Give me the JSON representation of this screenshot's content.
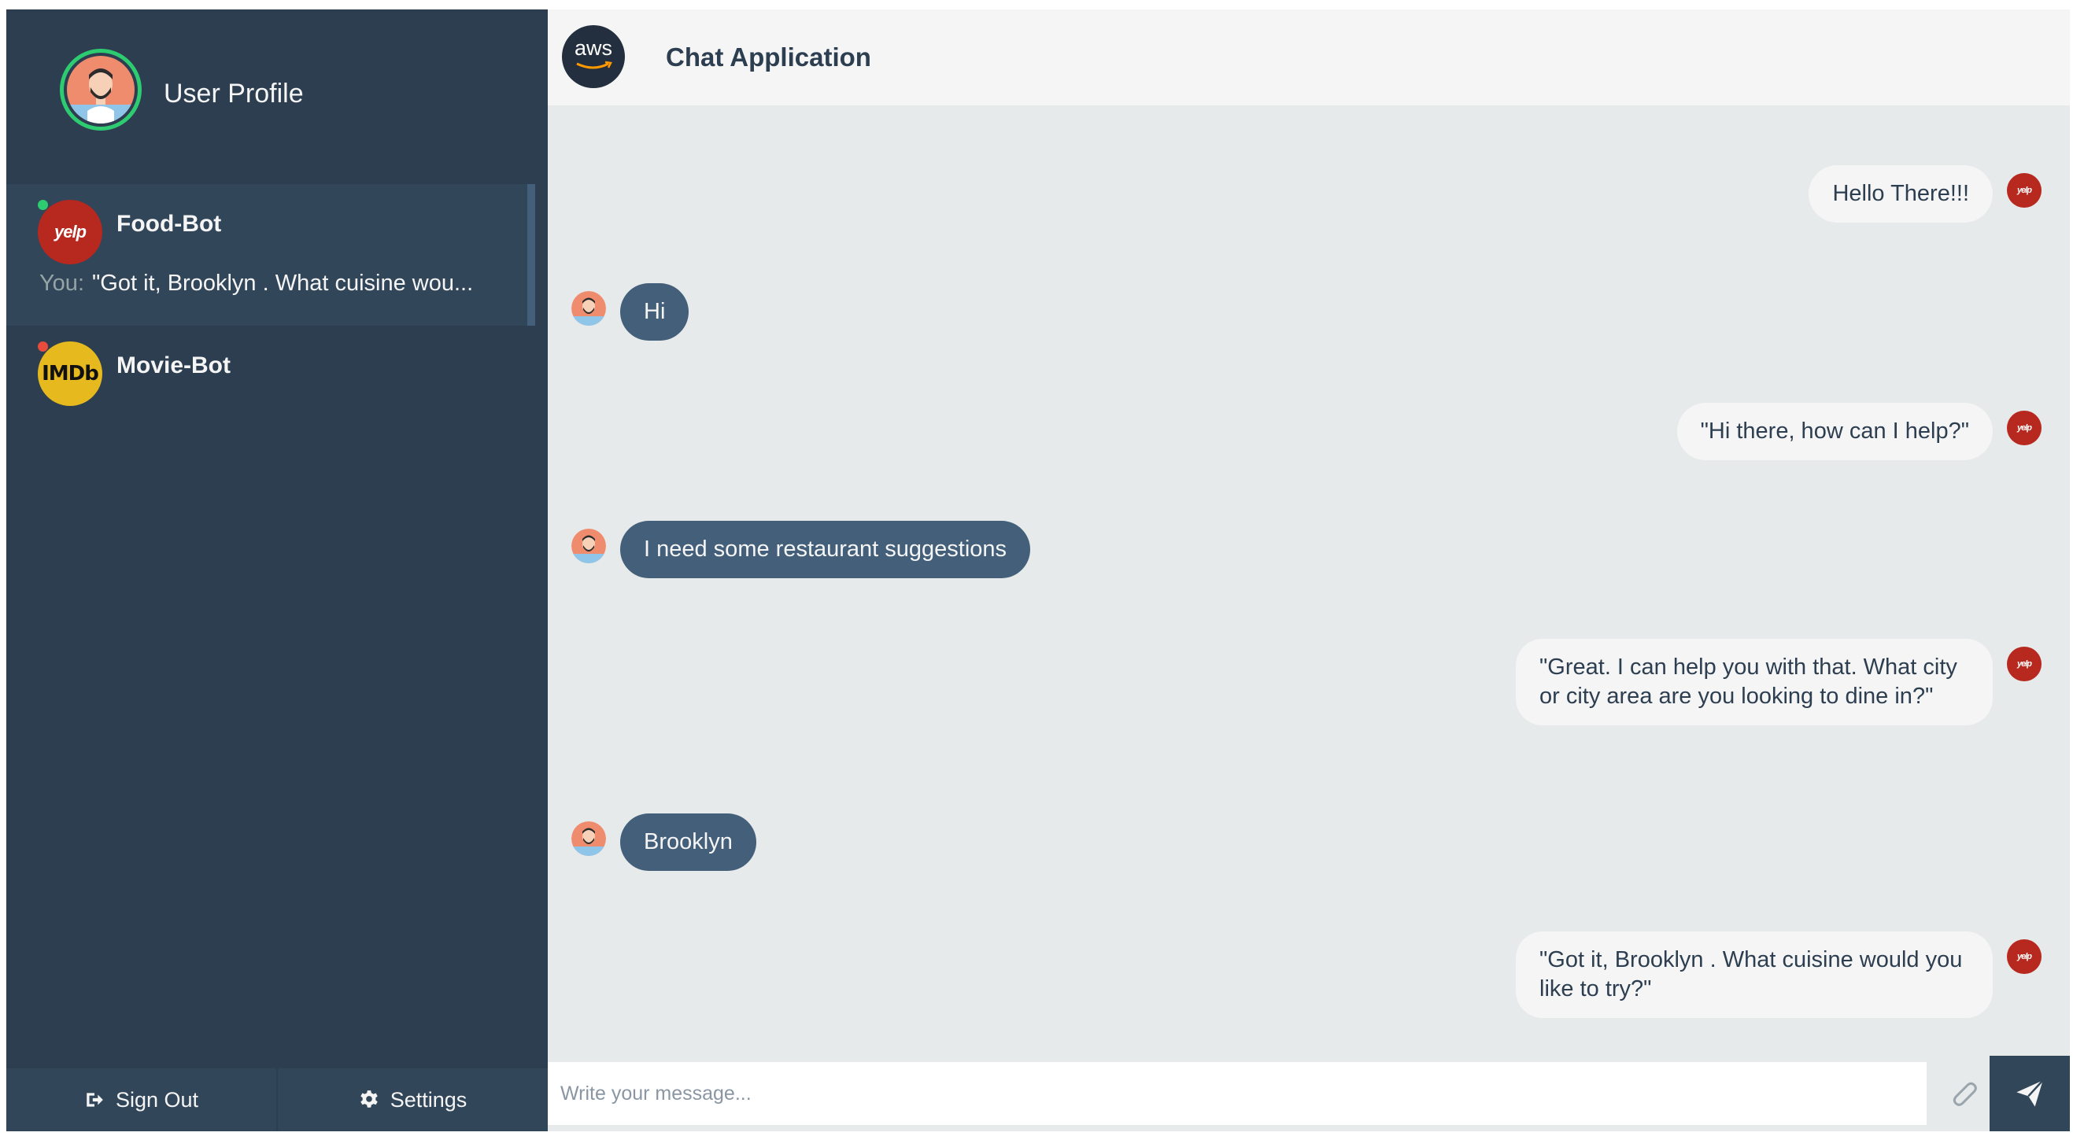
{
  "sidebar": {
    "profile": {
      "name": "User Profile"
    },
    "contacts": [
      {
        "name": "Food-Bot",
        "status_color": "#2ecc71",
        "logo_text": "yelp",
        "preview_prefix": "You:",
        "preview": "\"Got it, Brooklyn . What cuisine wou..."
      },
      {
        "name": "Movie-Bot",
        "status_color": "#e74c3c",
        "logo_text": "IMDb"
      }
    ],
    "bottom": {
      "signout_label": "Sign Out",
      "settings_label": "Settings"
    }
  },
  "header": {
    "logo_text": "aws",
    "title": "Chat Application"
  },
  "messages": [
    {
      "from": "bot",
      "text": "Hello There!!!"
    },
    {
      "from": "user",
      "text": "Hi"
    },
    {
      "from": "bot",
      "text": "\"Hi there, how can I help?\""
    },
    {
      "from": "user",
      "text": "I need some restaurant suggestions"
    },
    {
      "from": "bot",
      "text": "\"Great. I can help you with that. What city or city area are you looking to dine in?\""
    },
    {
      "from": "user",
      "text": "Brooklyn"
    },
    {
      "from": "bot",
      "text": "\"Got it, Brooklyn . What cuisine would you like to try?\""
    }
  ],
  "composer": {
    "placeholder": "Write your message...",
    "value": ""
  },
  "colors": {
    "sidebar": "#2c3e50",
    "active_contact": "#32465a",
    "user_bubble": "#435f7a",
    "bot_bubble": "#f5f5f5",
    "online": "#2ecc71",
    "offline": "#e74c3c"
  }
}
